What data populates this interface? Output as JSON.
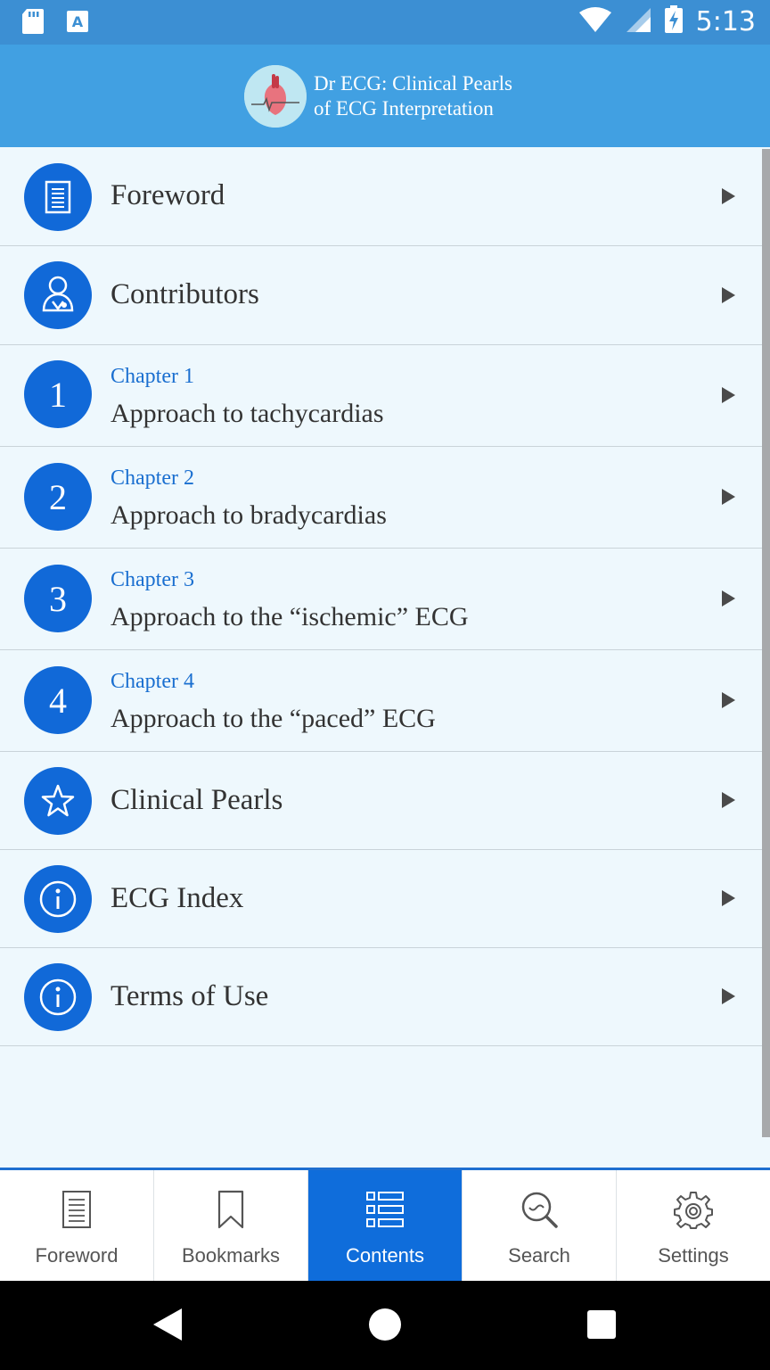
{
  "status_bar": {
    "time": "5:13",
    "icons": [
      "sd-card-icon",
      "keyboard-a-icon",
      "wifi-icon",
      "signal-icon",
      "battery-charging-icon"
    ]
  },
  "app": {
    "title_line1": "Dr ECG: Clinical Pearls",
    "title_line2": "of ECG Interpretation",
    "logo_icon": "heart-ecg-logo"
  },
  "list": {
    "foreword": "Foreword",
    "contributors": "Contributors",
    "chapters": [
      {
        "number": "1",
        "chapter": "Chapter 1",
        "title": "Approach to tachycardias"
      },
      {
        "number": "2",
        "chapter": "Chapter 2",
        "title": "Approach to bradycardias"
      },
      {
        "number": "3",
        "chapter": "Chapter 3",
        "title": "Approach to the “ischemic” ECG"
      },
      {
        "number": "4",
        "chapter": "Chapter 4",
        "title": "Approach to the “paced” ECG"
      }
    ],
    "clinical_pearls": "Clinical Pearls",
    "ecg_index": "ECG Index",
    "terms_of_use": "Terms of Use"
  },
  "bottom_nav": {
    "active": "Contents",
    "tabs": [
      {
        "label": "Foreword",
        "icon": "document-icon"
      },
      {
        "label": "Bookmarks",
        "icon": "bookmark-icon"
      },
      {
        "label": "Contents",
        "icon": "list-icon"
      },
      {
        "label": "Search",
        "icon": "search-icon"
      },
      {
        "label": "Settings",
        "icon": "gear-icon"
      }
    ]
  },
  "colors": {
    "status_bar": "#3c8fd3",
    "app_bar": "#41a0e2",
    "badge": "#1169d8",
    "chapter_text": "#1a6fd0",
    "active_tab": "#0f6ddb",
    "list_bg": "#eef8fd"
  }
}
